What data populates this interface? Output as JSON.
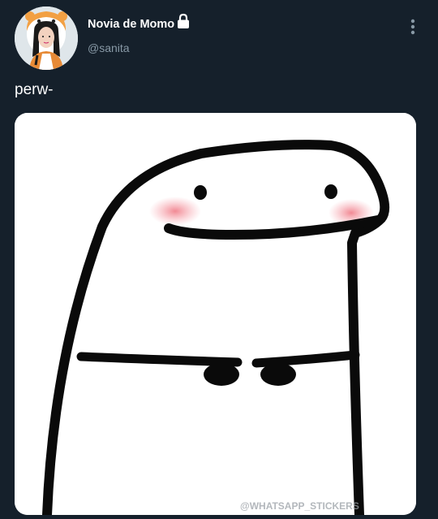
{
  "user": {
    "display_name": "Novia de Momo",
    "handle": "@sanita",
    "protected_icon": "lock-icon",
    "avatar_icon": "profile-photo"
  },
  "tweet": {
    "text": "perw-",
    "media_icon": "flork-meme-sticker",
    "media_watermark": "@WHATSAPP_STICKERS"
  },
  "menu": {
    "icon": "more-vertical-icon"
  },
  "colors": {
    "background": "#15202b",
    "primary_text": "#ffffff",
    "secondary_text": "#8899a6",
    "blush": "#f08a94"
  }
}
